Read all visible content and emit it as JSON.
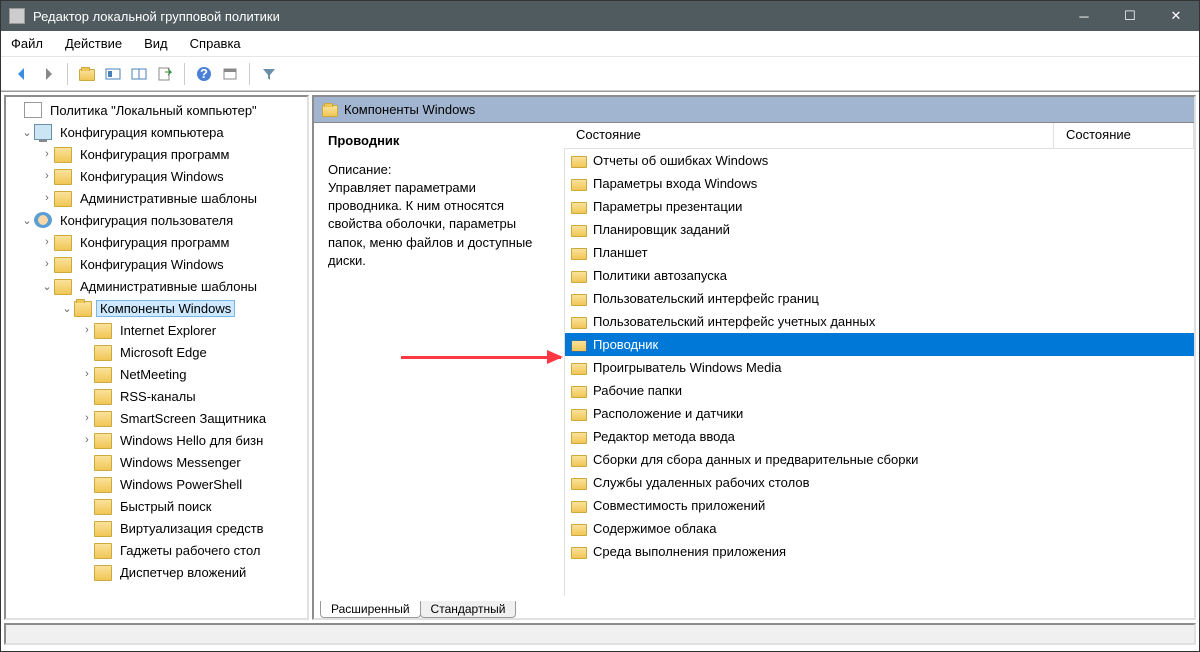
{
  "window": {
    "title": "Редактор локальной групповой политики"
  },
  "menu": {
    "file": "Файл",
    "action": "Действие",
    "view": "Вид",
    "help": "Справка"
  },
  "tree": {
    "root": "Политика \"Локальный компьютер\"",
    "computer_config": "Конфигурация компьютера",
    "user_config": "Конфигурация пользователя",
    "software_config": "Конфигурация программ",
    "windows_config": "Конфигурация Windows",
    "admin_templates": "Административные шаблоны",
    "win_components": "Компоненты Windows",
    "ie": "Internet Explorer",
    "edge": "Microsoft Edge",
    "netmeeting": "NetMeeting",
    "rss": "RSS-каналы",
    "smartscreen": "SmartScreen Защитника",
    "hello": "Windows Hello для бизн",
    "messenger": "Windows Messenger",
    "powershell": "Windows PowerShell",
    "quicksearch": "Быстрый поиск",
    "virtualization": "Виртуализация средств",
    "gadgets": "Гаджеты рабочего стол",
    "dispatcher": "Диспетчер вложений"
  },
  "path_header": "Компоненты Windows",
  "columns": {
    "state": "Состояние",
    "state2": "Состояние"
  },
  "selected_item": {
    "name": "Проводник",
    "desc_label": "Описание:",
    "desc_text": "Управляет параметрами проводника. К ним относятся свойства оболочки, параметры папок, меню файлов и доступные диски."
  },
  "list_items": [
    "Отчеты об ошибках Windows",
    "Параметры входа Windows",
    "Параметры презентации",
    "Планировщик заданий",
    "Планшет",
    "Политики автозапуска",
    "Пользовательский интерфейс границ",
    "Пользовательский интерфейс учетных данных",
    "Проводник",
    "Проигрыватель Windows Media",
    "Рабочие папки",
    "Расположение и датчики",
    "Редактор метода ввода",
    "Сборки для сбора данных и предварительные сборки",
    "Службы удаленных рабочих столов",
    "Совместимость приложений",
    "Содержимое облака",
    "Среда выполнения приложения"
  ],
  "selected_list_index": 8,
  "tabs": {
    "extended": "Расширенный",
    "standard": "Стандартный"
  }
}
